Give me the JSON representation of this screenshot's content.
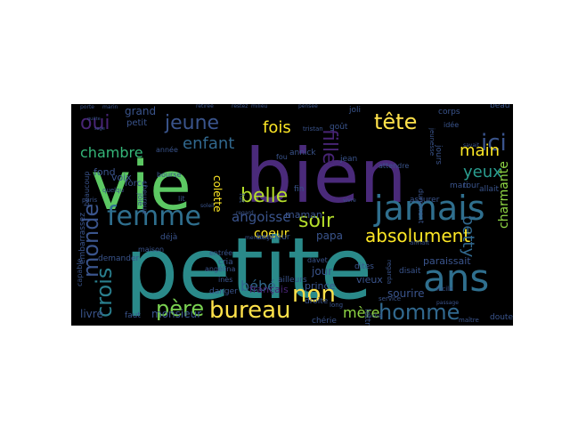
{
  "word_cloud": {
    "background": "#000000",
    "palette": "viridis",
    "words": [
      {
        "text": "petite",
        "color": "#2a8a8a"
      },
      {
        "text": "vie",
        "color": "#5cc863"
      },
      {
        "text": "bien",
        "color": "#4a2a7a"
      },
      {
        "text": "jamais",
        "color": "#2f6f8e"
      },
      {
        "text": "femme",
        "color": "#2f6f8e"
      },
      {
        "text": "ans",
        "color": "#2f6f8e"
      },
      {
        "text": "ici",
        "color": "#3a548c"
      },
      {
        "text": "tête",
        "color": "#ffe24a"
      },
      {
        "text": "jeune",
        "color": "#3a548c"
      },
      {
        "text": "oui",
        "color": "#482475"
      },
      {
        "text": "monde",
        "color": "#3a548c"
      },
      {
        "text": "crois",
        "color": "#2a7f8e"
      },
      {
        "text": "père",
        "color": "#7ad151"
      },
      {
        "text": "bureau",
        "color": "#ffe24a"
      },
      {
        "text": "non",
        "color": "#ffe24a"
      },
      {
        "text": "homme",
        "color": "#31688e"
      },
      {
        "text": "fille",
        "color": "#482475"
      },
      {
        "text": "belle",
        "color": "#b5de2b"
      },
      {
        "text": "soir",
        "color": "#b5de2b"
      },
      {
        "text": "enfant",
        "color": "#31688e"
      },
      {
        "text": "main",
        "color": "#fde725"
      },
      {
        "text": "yeux",
        "color": "#2a9d8f"
      },
      {
        "text": "absolument",
        "color": "#fde725"
      },
      {
        "text": "betty",
        "color": "#31688e"
      },
      {
        "text": "charmante",
        "color": "#8fd744"
      },
      {
        "text": "fois",
        "color": "#fde725"
      },
      {
        "text": "chambre",
        "color": "#35b779"
      },
      {
        "text": "angoisse",
        "color": "#3a548c"
      },
      {
        "text": "coeur",
        "color": "#fde725"
      },
      {
        "text": "mère",
        "color": "#8fd744"
      },
      {
        "text": "fils",
        "color": "#3a548c"
      },
      {
        "text": "bébé",
        "color": "#31688e"
      },
      {
        "text": "colette",
        "color": "#fde725"
      },
      {
        "text": "papa",
        "color": "#3a548c"
      },
      {
        "text": "grand",
        "color": "#3a548c"
      },
      {
        "text": "livre",
        "color": "#3a548c"
      },
      {
        "text": "monsieur",
        "color": "#3a548c"
      },
      {
        "text": "sourire",
        "color": "#3a548c"
      },
      {
        "text": "jour",
        "color": "#3a548c"
      },
      {
        "text": "prince",
        "color": "#3a548c"
      },
      {
        "text": "maman",
        "color": "#3a548c"
      },
      {
        "text": "paraissait",
        "color": "#3a548c"
      },
      {
        "text": "vieux",
        "color": "#3a548c"
      },
      {
        "text": "français",
        "color": "#482475"
      },
      {
        "text": "voix",
        "color": "#3a548c"
      },
      {
        "text": "fond",
        "color": "#3a548c"
      },
      {
        "text": "petit",
        "color": "#3a548c"
      },
      {
        "text": "force",
        "color": "#3a548c"
      },
      {
        "text": "demander",
        "color": "#3a548c"
      },
      {
        "text": "déjà",
        "color": "#3a548c"
      },
      {
        "text": "cria",
        "color": "#3a548c"
      },
      {
        "text": "danger",
        "color": "#3a548c"
      },
      {
        "text": "faut",
        "color": "#3a548c"
      },
      {
        "text": "disait",
        "color": "#3a548c"
      },
      {
        "text": "ailleurs",
        "color": "#3a548c"
      },
      {
        "text": "droite",
        "color": "#3a548c"
      },
      {
        "text": "chérie",
        "color": "#3a548c"
      },
      {
        "text": "jean",
        "color": "#3a548c"
      },
      {
        "text": "annick",
        "color": "#3a548c"
      },
      {
        "text": "tour",
        "color": "#3a548c"
      },
      {
        "text": "assurer",
        "color": "#3a548c"
      },
      {
        "text": "bonheur",
        "color": "#3a548c"
      },
      {
        "text": "dites",
        "color": "#3a548c"
      },
      {
        "text": "fin",
        "color": "#3a548c"
      },
      {
        "text": "goût",
        "color": "#3a548c"
      },
      {
        "text": "joli",
        "color": "#3a548c"
      },
      {
        "text": "corps",
        "color": "#3a548c"
      },
      {
        "text": "beau",
        "color": "#3a548c"
      },
      {
        "text": "allait",
        "color": "#3a548c"
      },
      {
        "text": "mari",
        "color": "#3a548c"
      },
      {
        "text": "doute",
        "color": "#3a548c"
      },
      {
        "text": "lettre",
        "color": "#3a548c"
      },
      {
        "text": "année",
        "color": "#3a548c"
      },
      {
        "text": "maison",
        "color": "#3a548c"
      },
      {
        "text": "entrée",
        "color": "#3a548c"
      },
      {
        "text": "angélina",
        "color": "#3a548c"
      },
      {
        "text": "inès",
        "color": "#3a548c"
      },
      {
        "text": "capable",
        "color": "#3a548c"
      },
      {
        "text": "embarrassez",
        "color": "#3a548c"
      },
      {
        "text": "beaucoup",
        "color": "#3a548c"
      },
      {
        "text": "paris",
        "color": "#3a548c"
      },
      {
        "text": "lit",
        "color": "#3a548c"
      },
      {
        "text": "fut",
        "color": "#3a548c"
      },
      {
        "text": "fou",
        "color": "#3a548c"
      },
      {
        "text": "davet",
        "color": "#3a548c"
      },
      {
        "text": "long",
        "color": "#3a548c"
      },
      {
        "text": "service",
        "color": "#3a548c"
      },
      {
        "text": "michel",
        "color": "#3a548c"
      },
      {
        "text": "lucile",
        "color": "#3a548c"
      },
      {
        "text": "attendre",
        "color": "#3a548c"
      },
      {
        "text": "jours",
        "color": "#3a548c"
      },
      {
        "text": "idée",
        "color": "#3a548c"
      },
      {
        "text": "durement",
        "color": "#3a548c"
      },
      {
        "text": "tristan",
        "color": "#3a548c"
      },
      {
        "text": "pensée",
        "color": "#3a548c"
      },
      {
        "text": "regard",
        "color": "#3a548c"
      },
      {
        "text": "heureux",
        "color": "#3a548c"
      },
      {
        "text": "bourse",
        "color": "#3a548c"
      },
      {
        "text": "quelqu",
        "color": "#3a548c"
      },
      {
        "text": "porte",
        "color": "#3a548c"
      },
      {
        "text": "marin",
        "color": "#3a548c"
      },
      {
        "text": "retirée",
        "color": "#3a548c"
      },
      {
        "text": "restez",
        "color": "#3a548c"
      },
      {
        "text": "milieu",
        "color": "#3a548c"
      },
      {
        "text": "passage",
        "color": "#3a548c"
      },
      {
        "text": "maître",
        "color": "#3a548c"
      },
      {
        "text": "aimait",
        "color": "#3a548c"
      },
      {
        "text": "regarda",
        "color": "#3a548c"
      },
      {
        "text": "jeunesse",
        "color": "#3a548c"
      },
      {
        "text": "quitte",
        "color": "#3a548c"
      },
      {
        "text": "sage",
        "color": "#3a548c"
      },
      {
        "text": "soleil",
        "color": "#3a548c"
      },
      {
        "text": "vivre",
        "color": "#3a548c"
      },
      {
        "text": "mensonge",
        "color": "#3a548c"
      },
      {
        "text": "savait",
        "color": "#3a548c"
      },
      {
        "text": "joie",
        "color": "#3a548c"
      }
    ]
  }
}
